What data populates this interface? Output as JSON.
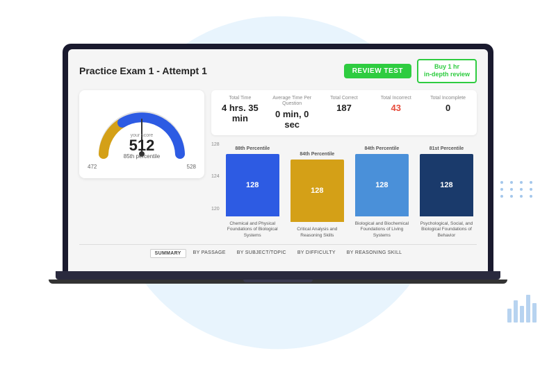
{
  "background": {
    "circle_color": "#d6eaf8"
  },
  "header": {
    "title": "Practice Exam 1 - Attempt 1",
    "review_btn": "RevIEW TeST",
    "buy_btn_line1": "Buy 1 hr",
    "buy_btn_line2": "in-depth review"
  },
  "stats": {
    "total_time_label": "Total Time",
    "total_time_value": "4 hrs. 35 min",
    "avg_time_label": "Average Time Per Question",
    "avg_time_value": "0 min, 0 sec",
    "total_correct_label": "Total Correct",
    "total_correct_value": "187",
    "total_incorrect_label": "Total Incorrect",
    "total_incorrect_value": "43",
    "total_incomplete_label": "Total Incomplete",
    "total_incomplete_value": "0"
  },
  "score": {
    "your_score_label": "your score",
    "value": "512",
    "percentile": "85th percentile",
    "range_low": "472",
    "range_high": "528"
  },
  "chart": {
    "columns": [
      {
        "percentile": "88th Percentile",
        "bar_value": "128",
        "color": "blue",
        "label": "Chemical and Physical Foundations of Biological Systems"
      },
      {
        "percentile": "84th Percentile",
        "bar_value": "128",
        "color": "gold",
        "label": "Critical Analysis and Reasoning Skills"
      },
      {
        "percentile": "84th Percentile",
        "bar_value": "128",
        "color": "mid-blue",
        "label": "Biological and Biochemical Foundations of Living Systems"
      },
      {
        "percentile": "81st Percentile",
        "bar_value": "128",
        "color": "dark-blue",
        "label": "Psychological, Social, and Biological Foundations of Behavior"
      }
    ],
    "y_labels": [
      "128",
      "124",
      "120"
    ]
  },
  "tabs": [
    {
      "label": "SUMMARY",
      "active": true
    },
    {
      "label": "BY PASSAGE",
      "active": false
    },
    {
      "label": "BY SUBJECT/TOPIC",
      "active": false
    },
    {
      "label": "BY DIFFICULTY",
      "active": false
    },
    {
      "label": "BY REASONING SKILL",
      "active": false
    }
  ]
}
